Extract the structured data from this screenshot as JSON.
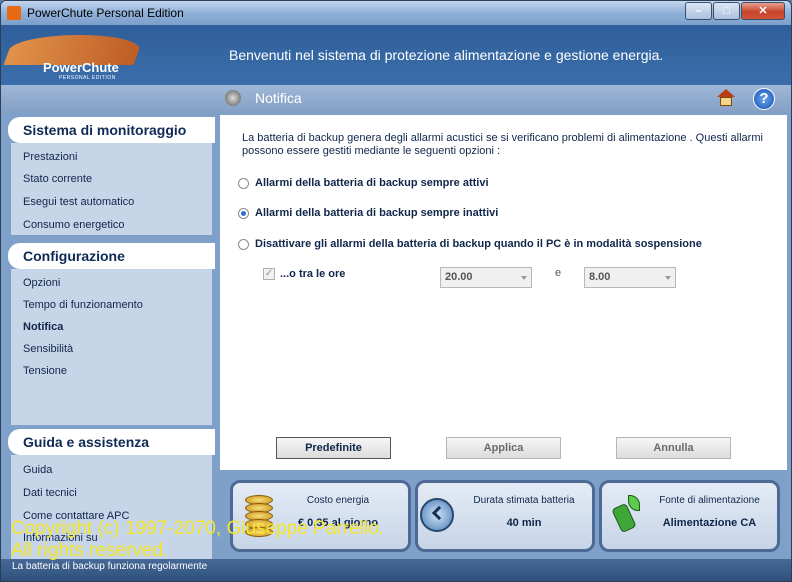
{
  "window": {
    "title": "PowerChute Personal Edition",
    "buttons": {
      "minimize": "–",
      "maximize": "□",
      "close": "✕"
    }
  },
  "header": {
    "logo_name": "PowerChute",
    "logo_sub": "PERSONAL EDITION",
    "welcome": "Benvenuti nel sistema di protezione alimentazione e gestione energia."
  },
  "subbar": {
    "title": "Notifica",
    "help_glyph": "?"
  },
  "sidebar": {
    "sections": [
      {
        "title": "Sistema di monitoraggio",
        "items": [
          "Prestazioni",
          "Stato corrente",
          "Esegui test automatico",
          "Consumo energetico"
        ]
      },
      {
        "title": "Configurazione",
        "items": [
          "Opzioni",
          "Tempo di funzionamento",
          "Notifica",
          "Sensibilità",
          "Tensione"
        ],
        "active_index": 2
      },
      {
        "title": "Guida e assistenza",
        "items": [
          "Guida",
          "Dati tecnici",
          "Come contattare APC",
          "Informazioni su"
        ]
      }
    ]
  },
  "main": {
    "description": "La batteria di backup genera degli allarmi acustici se si verificano problemi di alimentazione . Questi allarmi possono essere gestiti mediante le seguenti opzioni :",
    "options": [
      {
        "label": "Allarmi della batteria di backup sempre attivi",
        "checked": false
      },
      {
        "label": "Allarmi della batteria di backup sempre inattivi",
        "checked": true
      },
      {
        "label": "Disattivare gli allarmi della batteria di backup quando il PC è in modalità sospensione",
        "checked": false
      }
    ],
    "time_range": {
      "checkbox_label": "...o tra le ore",
      "checkbox_glyph": "✓",
      "from": "20.00",
      "separator": "e",
      "to": "8.00"
    },
    "buttons": {
      "defaults": "Predefinite",
      "apply": "Applica",
      "cancel": "Annulla"
    }
  },
  "status_panels": [
    {
      "title": "Costo energia",
      "value": "€ 0,35 al giorno",
      "icon": "coins-icon"
    },
    {
      "title": "Durata stimata batteria",
      "value": "40 min",
      "icon": "clock-icon"
    },
    {
      "title": "Fonte di alimentazione",
      "value": "Alimentazione CA",
      "icon": "plug-icon"
    }
  ],
  "statusbar": {
    "text": "La batteria di backup funziona regolarmente"
  },
  "watermark": {
    "line1": "Copyright (c) 1997-2070, Giuseppe Parrello.",
    "line2": "All rights reserved."
  }
}
